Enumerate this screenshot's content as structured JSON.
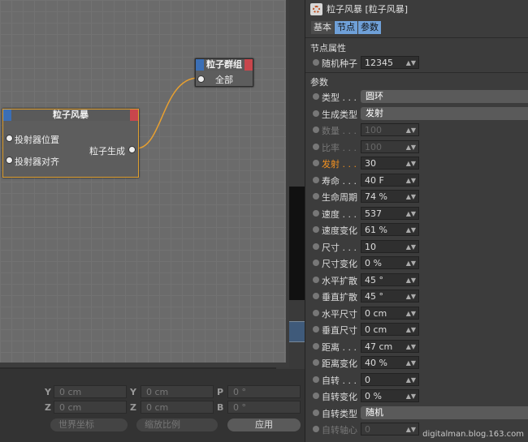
{
  "editor": {
    "node_storm": {
      "title": "粒子风暴",
      "inputs": [
        "投射器位置",
        "投射器对齐"
      ],
      "output": "粒子生成"
    },
    "node_group": {
      "title": "粒子群组",
      "input": "全部"
    }
  },
  "coords": {
    "rows": [
      {
        "l1": "Y",
        "v1": "0 cm",
        "l2": "Y",
        "v2": "0 cm",
        "l3": "P",
        "v3": "0 °"
      },
      {
        "l1": "Z",
        "v1": "0 cm",
        "l2": "Z",
        "v2": "0 cm",
        "l3": "B",
        "v3": "0 °"
      }
    ],
    "world_coords": "世界坐标",
    "scale": "缩放比例",
    "apply": "应用"
  },
  "attr": {
    "title": "粒子风暴 [粒子风暴]",
    "tabs": [
      "基本",
      "节点",
      "参数"
    ],
    "section_node": "节点属性",
    "section_params": "参数",
    "seed_label": "随机种子",
    "seed_value": "12345",
    "rows": [
      {
        "label": "类型 . . .",
        "value": "圆环",
        "kind": "drop"
      },
      {
        "label": "生成类型",
        "value": "发射",
        "kind": "drop"
      },
      {
        "label": "数量 . . .",
        "value": "100",
        "kind": "dim"
      },
      {
        "label": "比率 . . .",
        "value": "100",
        "kind": "dim"
      },
      {
        "label": "发射 . . .",
        "value": "30",
        "kind": "orange"
      },
      {
        "label": "寿命 . . .",
        "value": "40 F",
        "kind": "num"
      },
      {
        "label": "生命周期",
        "value": "74 %",
        "kind": "num"
      },
      {
        "label": "速度 . . .",
        "value": "537",
        "kind": "num"
      },
      {
        "label": "速度变化",
        "value": "61 %",
        "kind": "num"
      },
      {
        "label": "尺寸 . . .",
        "value": "10",
        "kind": "num"
      },
      {
        "label": "尺寸变化",
        "value": "0 %",
        "kind": "num"
      },
      {
        "label": "水平扩散",
        "value": "45 °",
        "kind": "num"
      },
      {
        "label": "垂直扩散",
        "value": "45 °",
        "kind": "num"
      },
      {
        "label": "水平尺寸",
        "value": "0 cm",
        "kind": "num"
      },
      {
        "label": "垂直尺寸",
        "value": "0 cm",
        "kind": "num"
      },
      {
        "label": "距离 . . .",
        "value": "47 cm",
        "kind": "num"
      },
      {
        "label": "距离变化",
        "value": "40 %",
        "kind": "num"
      },
      {
        "label": "自转 . . .",
        "value": "0",
        "kind": "num"
      },
      {
        "label": "自转变化",
        "value": "0 %",
        "kind": "num"
      },
      {
        "label": "自转类型",
        "value": "随机",
        "kind": "drop"
      },
      {
        "label": "自转轴心",
        "value": "0",
        "kind": "dim"
      }
    ],
    "footer": "digitalman.blog.163.com"
  }
}
